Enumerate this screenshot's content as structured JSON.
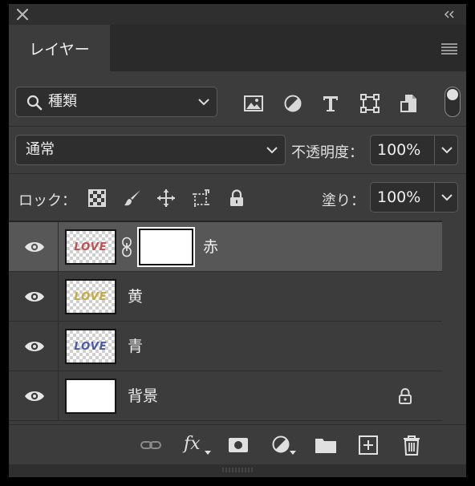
{
  "window": {
    "close_icon": "close-icon",
    "collapse_icon": "double-chevron-icon"
  },
  "tabs": [
    {
      "label": "レイヤー",
      "active": true
    }
  ],
  "filter": {
    "kind_label": "種類",
    "icons": [
      "image-filter-icon",
      "adjustment-filter-icon",
      "type-filter-icon",
      "shape-filter-icon",
      "smart-object-filter-icon"
    ],
    "toggle_on": true
  },
  "blend": {
    "mode": "通常",
    "opacity_label": "不透明度：",
    "opacity_value": "100%"
  },
  "lock": {
    "label": "ロック：",
    "icons": [
      "lock-transparent-icon",
      "lock-image-icon",
      "lock-position-icon",
      "lock-artboard-icon",
      "lock-all-icon"
    ],
    "fill_label": "塗り：",
    "fill_value": "100%"
  },
  "layers": [
    {
      "name": "赤",
      "visible": true,
      "selected": true,
      "thumb_text": "LOVE",
      "thumb_color": "#c0504d",
      "has_mask": true,
      "locked": false
    },
    {
      "name": "黄",
      "visible": true,
      "selected": false,
      "thumb_text": "LOVE",
      "thumb_color": "#c8a93c",
      "has_mask": false,
      "locked": false
    },
    {
      "name": "青",
      "visible": true,
      "selected": false,
      "thumb_text": "LOVE",
      "thumb_color": "#4a5aa8",
      "has_mask": false,
      "locked": false
    },
    {
      "name": "背景",
      "visible": true,
      "selected": false,
      "thumb_text": "",
      "thumb_color": "#ffffff",
      "has_mask": false,
      "locked": true
    }
  ],
  "footer": {
    "icons": [
      "link-layers-icon",
      "fx-icon",
      "add-mask-icon",
      "adjustment-layer-icon",
      "new-group-icon",
      "new-layer-icon",
      "delete-icon"
    ],
    "fx_label": "fx"
  },
  "colors": {
    "panel_bg": "#3c3c3c",
    "selected_row": "#575757",
    "field_bg": "#2e2e2e"
  }
}
